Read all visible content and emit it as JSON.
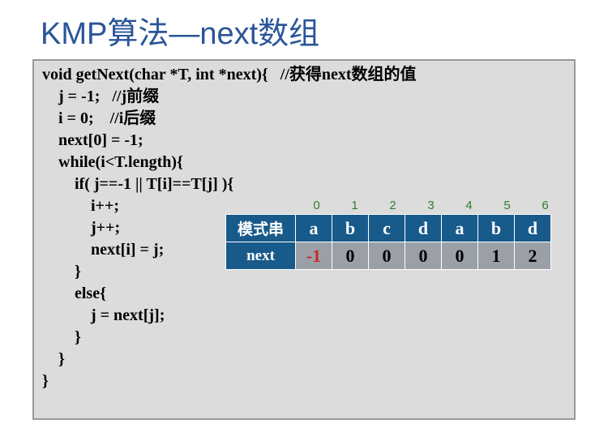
{
  "title": "KMP算法—next数组",
  "code": "void getNext(char *T, int *next){   //获得next数组的值\n    j = -1;   //j前缀\n    i = 0;    //i后缀\n    next[0] = -1;\n    while(i<T.length){\n        if( j==-1 || T[i]==T[j] ){\n            i++;\n            j++;\n            next[i] = j;\n        }\n        else{\n            j = next[j];\n        }\n    }\n}",
  "chart_data": {
    "type": "table",
    "col_indices": [
      "0",
      "1",
      "2",
      "3",
      "4",
      "5",
      "6"
    ],
    "rows": [
      {
        "label": "模式串",
        "cells": [
          "a",
          "b",
          "c",
          "d",
          "a",
          "b",
          "d"
        ]
      },
      {
        "label": "next",
        "cells": [
          "-1",
          "0",
          "0",
          "0",
          "0",
          "1",
          "2"
        ]
      }
    ],
    "highlight": {
      "row": 1,
      "col": 0
    }
  }
}
